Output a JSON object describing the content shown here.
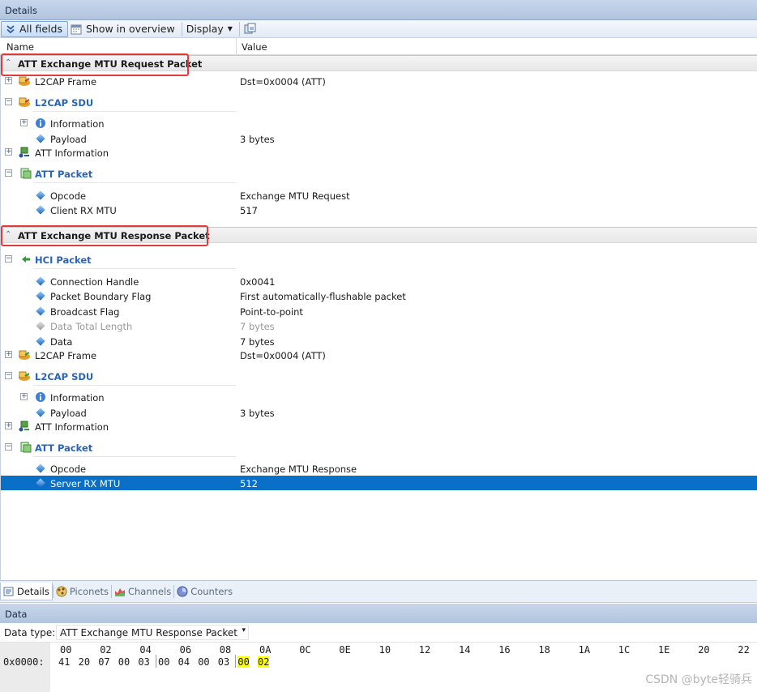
{
  "panel_title": "Details",
  "toolbar": {
    "all_fields": "All fields",
    "show_overview": "Show in overview",
    "display": "Display"
  },
  "columns": {
    "name": "Name",
    "value": "Value"
  },
  "request": {
    "title": "ATT Exchange MTU Request Packet",
    "l2cap_frame": {
      "name": "L2CAP Frame",
      "value": "Dst=0x0004 (ATT)"
    },
    "l2cap_sdu": "L2CAP SDU",
    "information": "Information",
    "payload": {
      "name": "Payload",
      "value": "3 bytes"
    },
    "att_information": "ATT Information",
    "att_packet": "ATT Packet",
    "opcode": {
      "name": "Opcode",
      "value": "Exchange MTU Request"
    },
    "mtu": {
      "name": "Client RX MTU",
      "value": "517"
    }
  },
  "response": {
    "title": "ATT Exchange MTU Response Packet",
    "hci_packet": "HCI Packet",
    "connection_handle": {
      "name": "Connection Handle",
      "value": "0x0041"
    },
    "boundary_flag": {
      "name": "Packet Boundary Flag",
      "value": "First automatically-flushable packet"
    },
    "broadcast_flag": {
      "name": "Broadcast Flag",
      "value": "Point-to-point"
    },
    "data_total_length": {
      "name": "Data Total Length",
      "value": "7 bytes"
    },
    "data": {
      "name": "Data",
      "value": "7 bytes"
    },
    "l2cap_frame": {
      "name": "L2CAP Frame",
      "value": "Dst=0x0004 (ATT)"
    },
    "l2cap_sdu": "L2CAP SDU",
    "information": "Information",
    "payload": {
      "name": "Payload",
      "value": "3 bytes"
    },
    "att_information": "ATT Information",
    "att_packet": "ATT Packet",
    "opcode": {
      "name": "Opcode",
      "value": "Exchange MTU Response"
    },
    "mtu": {
      "name": "Server RX MTU",
      "value": "512"
    }
  },
  "bottom_tabs": [
    "Details",
    "Piconets",
    "Channels",
    "Counters"
  ],
  "data_panel": {
    "title": "Data",
    "type_label": "Data type:",
    "type_value": "ATT Exchange MTU Response Packet",
    "ruler": [
      "00",
      "02",
      "04",
      "06",
      "08",
      "0A",
      "0C",
      "0E",
      "10",
      "12",
      "14",
      "16",
      "18",
      "1A",
      "1C",
      "1E",
      "20",
      "22"
    ],
    "address": "0x0000:",
    "bytes": [
      "41",
      "20",
      "07",
      "00",
      "03",
      "00",
      "04",
      "00",
      "03",
      "00",
      "02"
    ],
    "highlight_from": 9
  },
  "watermark": "CSDN @byte轻骑兵",
  "colors": {
    "selection": "#0a6fc7",
    "group_title": "#2a64b6",
    "highlight_box": "#e33b3b",
    "hex_highlight": "#ffff00"
  }
}
